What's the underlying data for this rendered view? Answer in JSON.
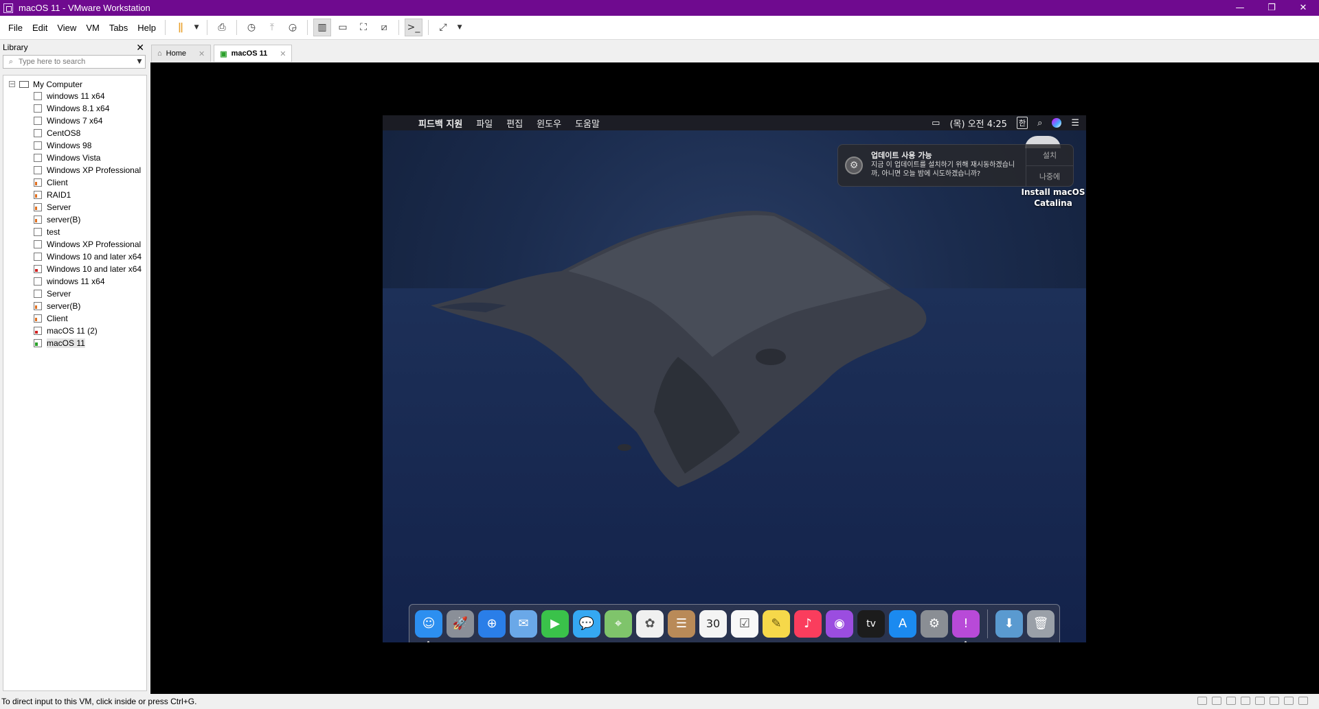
{
  "window": {
    "title": "macOS 11 - VMware Workstation",
    "controls": [
      "—",
      "❐",
      "✕"
    ]
  },
  "menu": [
    "File",
    "Edit",
    "View",
    "VM",
    "Tabs",
    "Help"
  ],
  "library": {
    "title": "Library",
    "search_placeholder": "Type here to search",
    "root": "My Computer",
    "vms": [
      {
        "name": "windows 11 x64",
        "status": "off"
      },
      {
        "name": "Windows 8.1 x64",
        "status": "off"
      },
      {
        "name": "Windows 7 x64",
        "status": "off"
      },
      {
        "name": "CentOS8",
        "status": "off"
      },
      {
        "name": "Windows 98",
        "status": "off"
      },
      {
        "name": "Windows Vista",
        "status": "off"
      },
      {
        "name": "Windows XP Professional",
        "status": "off"
      },
      {
        "name": "Client",
        "status": "suspended"
      },
      {
        "name": "RAID1",
        "status": "suspended"
      },
      {
        "name": "Server",
        "status": "suspended"
      },
      {
        "name": "server(B)",
        "status": "suspended"
      },
      {
        "name": "test",
        "status": "off"
      },
      {
        "name": "Windows XP Professional",
        "status": "off"
      },
      {
        "name": "Windows 10 and later x64",
        "status": "off"
      },
      {
        "name": "Windows 10 and later x64",
        "status": "error"
      },
      {
        "name": "windows 11 x64",
        "status": "off"
      },
      {
        "name": "Server",
        "status": "off"
      },
      {
        "name": "server(B)",
        "status": "suspended"
      },
      {
        "name": "Client",
        "status": "suspended"
      },
      {
        "name": "macOS 11 (2)",
        "status": "error"
      },
      {
        "name": "macOS 11",
        "status": "running"
      }
    ]
  },
  "tabs": [
    {
      "label": "Home",
      "active": false
    },
    {
      "label": "macOS 11",
      "active": true
    }
  ],
  "guest": {
    "menubar": {
      "app": "피드백 지원",
      "items": [
        "파일",
        "편집",
        "윈도우",
        "도움말"
      ],
      "clock": "(목) 오전 4:25",
      "input_indicator": "한"
    },
    "notification": {
      "title": "업데이트 사용 가능",
      "body": "지금 이 업데이트를 설치하기 위해 재시동하겠습니까, 아니면 오늘 밤에 시도하겠습니까?",
      "install": "설치",
      "later": "나중에"
    },
    "desktop_icon": {
      "label_line1": "Install macOS",
      "label_line2": "Catalina"
    },
    "dock": [
      {
        "name": "finder",
        "glyph": "☺",
        "color": "#2c8ff0",
        "dot": true
      },
      {
        "name": "launchpad",
        "glyph": "🚀",
        "color": "#8a8f98",
        "dot": false
      },
      {
        "name": "safari",
        "glyph": "⊕",
        "color": "#2a7ee8",
        "dot": false
      },
      {
        "name": "mail",
        "glyph": "✉",
        "color": "#6aa8e8",
        "dot": false
      },
      {
        "name": "facetime",
        "glyph": "▶",
        "color": "#3ac24a",
        "dot": false
      },
      {
        "name": "messages",
        "glyph": "💬",
        "color": "#35a8f2",
        "dot": false
      },
      {
        "name": "maps",
        "glyph": "⌖",
        "color": "#7fc46b",
        "dot": false
      },
      {
        "name": "photos",
        "glyph": "✿",
        "color": "#f0f0f0",
        "dot": false
      },
      {
        "name": "contacts",
        "glyph": "☰",
        "color": "#b98a58",
        "dot": false
      },
      {
        "name": "calendar",
        "glyph": "30",
        "color": "#f4f4f4",
        "dot": false
      },
      {
        "name": "reminders",
        "glyph": "☑",
        "color": "#f8f8f8",
        "dot": false
      },
      {
        "name": "notes",
        "glyph": "✎",
        "color": "#f6d84a",
        "dot": false
      },
      {
        "name": "music",
        "glyph": "♪",
        "color": "#fa3d5d",
        "dot": false
      },
      {
        "name": "podcasts",
        "glyph": "◉",
        "color": "#9b4de0",
        "dot": false
      },
      {
        "name": "tv",
        "glyph": "tv",
        "color": "#1c1c1c",
        "dot": false
      },
      {
        "name": "app-store",
        "glyph": "A",
        "color": "#1b8af0",
        "dot": false
      },
      {
        "name": "system-preferences",
        "glyph": "⚙",
        "color": "#8a8e94",
        "dot": false
      },
      {
        "name": "feedback-assistant",
        "glyph": "!",
        "color": "#b84ad8",
        "dot": true
      }
    ],
    "dock_extra": [
      {
        "name": "downloads",
        "glyph": "⬇",
        "color": "#5a9ad0"
      },
      {
        "name": "trash",
        "glyph": "🗑",
        "color": "#9aa0a8"
      }
    ]
  },
  "status": {
    "text": "To direct input to this VM, click inside or press Ctrl+G."
  }
}
